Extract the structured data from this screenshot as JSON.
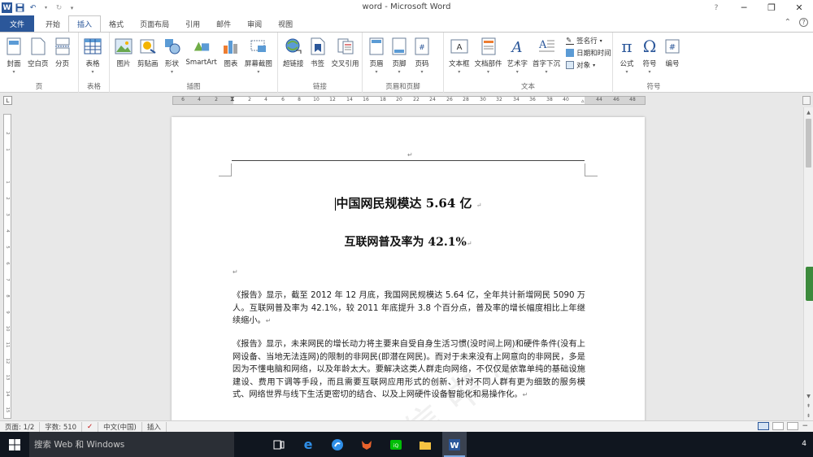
{
  "app": {
    "window_title": "word - Microsoft Word",
    "win_controls": [
      "?",
      "─",
      "❐",
      "✕"
    ]
  },
  "tabs": {
    "file": "文件",
    "items": [
      "开始",
      "插入",
      "格式",
      "页面布局",
      "引用",
      "邮件",
      "审阅",
      "视图"
    ],
    "active": "插入"
  },
  "ribbon": {
    "groups": {
      "pages": {
        "label": "页",
        "buttons": [
          "封面",
          "空白页",
          "分页"
        ]
      },
      "table": {
        "label": "表格",
        "buttons": [
          "表格"
        ]
      },
      "illustrations": {
        "label": "插图",
        "buttons": [
          "图片",
          "剪贴画",
          "形状",
          "SmartArt",
          "图表",
          "屏幕截图"
        ]
      },
      "links": {
        "label": "链接",
        "buttons": [
          "超链接",
          "书签",
          "交叉引用"
        ]
      },
      "header_footer": {
        "label": "页眉和页脚",
        "buttons": [
          "页眉",
          "页脚",
          "页码"
        ]
      },
      "text": {
        "label": "文本",
        "buttons": [
          "文本框",
          "文档部件",
          "艺术字",
          "首字下沉"
        ],
        "small": [
          "签名行",
          "日期和时间",
          "对象"
        ]
      },
      "symbols": {
        "label": "符号",
        "buttons": [
          "公式",
          "符号",
          "编号"
        ]
      }
    }
  },
  "ruler": {
    "ticks": [
      "6",
      "4",
      "2",
      "2",
      "4",
      "6",
      "8",
      "10",
      "12",
      "14",
      "16",
      "18",
      "20",
      "22",
      "24",
      "26",
      "28",
      "30",
      "32",
      "34",
      "36",
      "38",
      "40",
      "44",
      "46",
      "48"
    ],
    "vticks": [
      "2",
      "1",
      "1",
      "2",
      "3",
      "4",
      "5",
      "6",
      "7",
      "8",
      "9",
      "10",
      "11",
      "12",
      "13",
      "14",
      "15",
      "16",
      "17"
    ]
  },
  "document": {
    "header_mark": "↵",
    "title1": "中国网民规模达 5.64 亿",
    "title2": "互联网普及率为 42.1%",
    "pilcrow": "↵",
    "para1": "《报告》显示，截至 2012 年 12 月底，我国网民规模达 5.64 亿，全年共计新增网民 5090 万人。互联网普及率为 42.1%，较 2011 年底提升 3.8 个百分点，普及率的增长幅度相比上年继续缩小。",
    "para2": "《报告》显示，未来网民的增长动力将主要来自受自身生活习惯(没时间上网)和硬件条件(没有上网设备、当地无法连网)的限制的非网民(即潜在网民)。而对于未来没有上网意向的非网民，多是因为不懂电脑和网络，以及年龄太大。要解决这类人群走向网络，不仅仅是依靠单纯的基础设施建设、费用下调等手段，而且需要互联网应用形式的创新、针对不同人群有更为细致的服务模式、网络世界与线下生活更密切的结合、以及上网硬件设备智能化和易操作化。",
    "watermark": "信 中 心"
  },
  "statusbar": {
    "page": "页面: 1/2",
    "words": "字数: 510",
    "language": "中文(中国)",
    "mode": "插入"
  },
  "taskbar": {
    "search_placeholder": "搜索 Web 和 Windows",
    "clock": "4"
  }
}
